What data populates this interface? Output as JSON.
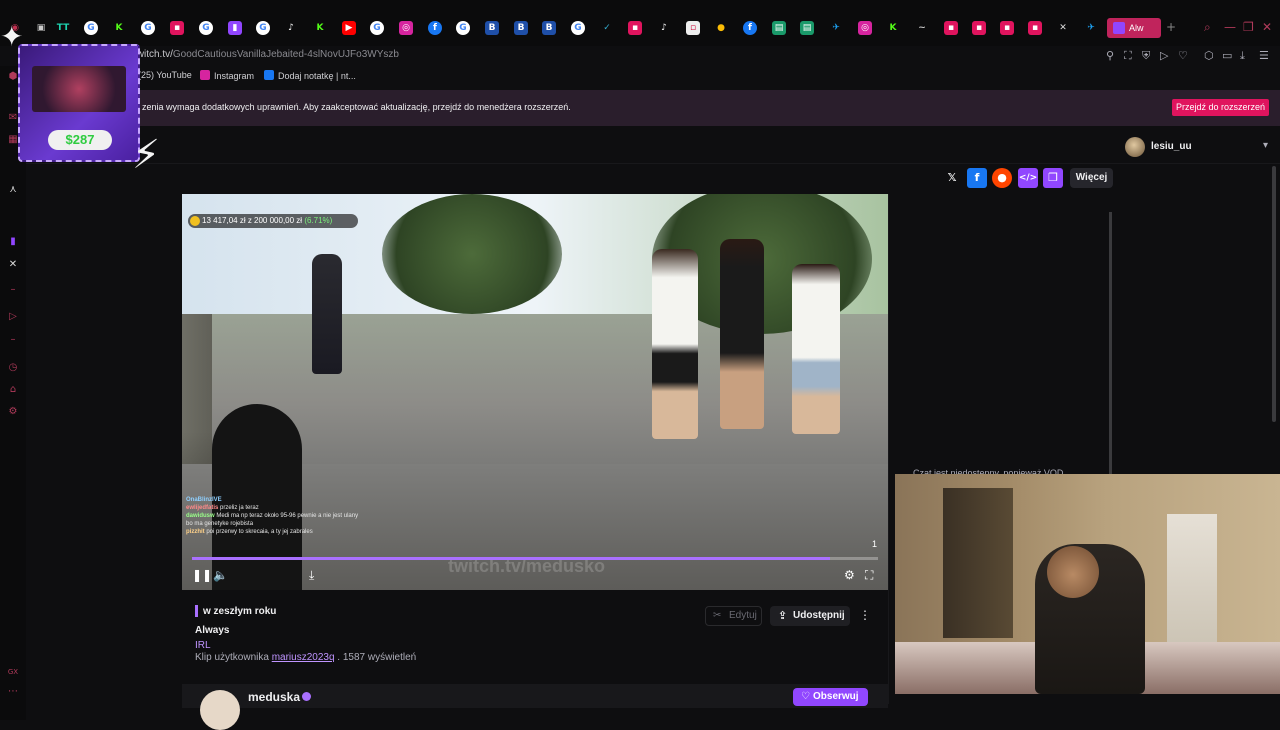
{
  "browser": {
    "url_prefix": "twitch.tv/",
    "url_path": "GoodCautiousVanillaJebaited-4slNovUJFo3WYszb",
    "active_tab_label": "Alw",
    "new_tab": "+",
    "bookmarks": [
      {
        "label": "(25) YouTube",
        "color": "#ff0000"
      },
      {
        "label": "Instagram",
        "color": "#d6249f"
      },
      {
        "label": "Dodaj notatkę | nt...",
        "color": "#1877f2"
      }
    ]
  },
  "banner": {
    "text": "zenia wymaga dodatkowych uprawnień. Aby zaakceptować aktualizację, przejdź do menedżera rozszerzeń.",
    "button": "Przejdź do rozszerzeń"
  },
  "gift_widget": {
    "amount": "$287"
  },
  "header": {
    "username": "lesiu_uu"
  },
  "share": {
    "more_label": "Więcej"
  },
  "video": {
    "donation_goal": "13 417,04 zł z 200 000,00 zł",
    "donation_pct": "(6.71%)",
    "watermark": "twitch.tv/medusko",
    "clip_number": "1",
    "progress": 0.93,
    "chat_lines": [
      {
        "name": "OnaBlinzIVE",
        "msg": ""
      },
      {
        "name": "ewlijedfatis",
        "msg": "przeliz ja teraz"
      },
      {
        "name": "dawidusw",
        "msg": "Medi ma np teraz około 95-96 pewnie a nie jest ulany bo ma genetyke rojebista"
      },
      {
        "name": "pizzhit",
        "msg": "poi przerwy to skrecaia, a ty jej zabrales"
      }
    ]
  },
  "clip": {
    "when": "w zeszłym roku",
    "title": "Always",
    "category": "IRL",
    "by_prefix": "Klip użytkownika",
    "by_user": "mariusz2023q",
    "views": "1587 wyświetleń",
    "edit_label": "Edytuj",
    "share_label": "Udostępnij"
  },
  "channel": {
    "name": "meduska",
    "follow_label": "Obserwuj"
  },
  "chat": {
    "unavailable": "Czat jest niedostępny, ponieważ VOD"
  }
}
